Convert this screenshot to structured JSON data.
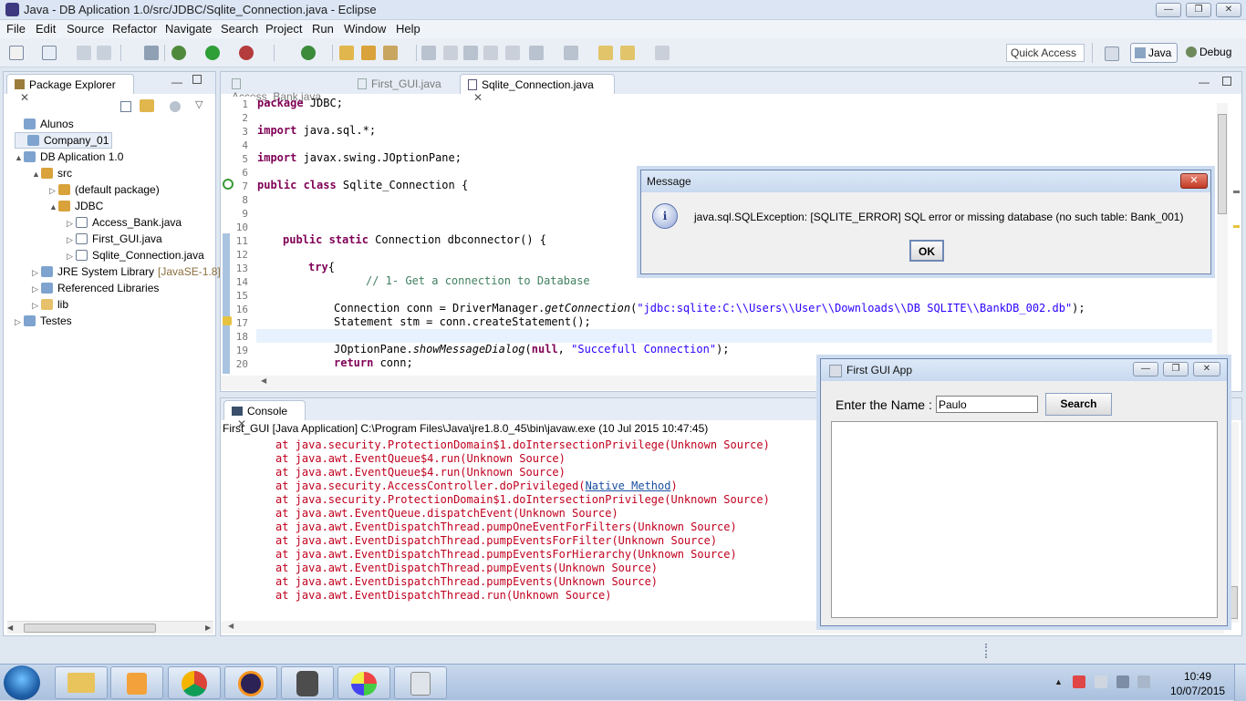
{
  "window": {
    "title": "Java - DB Aplication 1.0/src/JDBC/Sqlite_Connection.java - Eclipse"
  },
  "menu": [
    "File",
    "Edit",
    "Source",
    "Refactor",
    "Navigate",
    "Search",
    "Project",
    "Run",
    "Window",
    "Help"
  ],
  "toolbar": {
    "quick_access": "Quick Access",
    "perspectives": [
      "Java",
      "Debug"
    ]
  },
  "package_explorer": {
    "title": "Package Explorer",
    "items": [
      {
        "label": "Alunos",
        "depth": 0,
        "arrow": ""
      },
      {
        "label": "Company_01",
        "depth": 0,
        "arrow": ""
      },
      {
        "label": "DB Aplication 1.0",
        "depth": 0,
        "arrow": "▲"
      },
      {
        "label": "src",
        "depth": 1,
        "arrow": "▲"
      },
      {
        "label": "(default package)",
        "depth": 2,
        "arrow": "▷"
      },
      {
        "label": "JDBC",
        "depth": 2,
        "arrow": "▲"
      },
      {
        "label": "Access_Bank.java",
        "depth": 3,
        "arrow": "▷"
      },
      {
        "label": "First_GUI.java",
        "depth": 3,
        "arrow": "▷"
      },
      {
        "label": "Sqlite_Connection.java",
        "depth": 3,
        "arrow": "▷"
      },
      {
        "label": "JRE System Library",
        "suffix": "[JavaSE-1.8]",
        "depth": 1,
        "arrow": "▷"
      },
      {
        "label": "Referenced Libraries",
        "depth": 1,
        "arrow": "▷"
      },
      {
        "label": "lib",
        "depth": 1,
        "arrow": "▷"
      },
      {
        "label": "Testes",
        "depth": 0,
        "arrow": "▷"
      }
    ]
  },
  "editor": {
    "tabs": [
      "Access_Bank.java",
      "First_GUI.java",
      "Sqlite_Connection.java"
    ],
    "line_numbers": [
      "1",
      "2",
      "3",
      "4",
      "5",
      "6",
      "7",
      "8",
      "9",
      "10",
      "11",
      "12",
      "13",
      "14",
      "15",
      "16",
      "17",
      "18",
      "19",
      "20"
    ],
    "code": {
      "l1_kw": "package",
      "l1_rest": " JDBC;",
      "l3_kw": "import",
      "l3_rest": " java.sql.*;",
      "l5_kw": "import",
      "l5_rest": " javax.swing.JOptionPane;",
      "l7_kw": "public class",
      "l7_rest": " Sqlite_Connection {",
      "l11_kw": "public static",
      "l11_rest": " Connection dbconnector() {",
      "l13_kw": "try",
      "l13_rest": "{",
      "l14": "// 1- Get a connection to Database",
      "l16_a": "Connection conn = DriverManager.",
      "l16_m": "getConnection",
      "l16_p": "(",
      "l16_s": "\"jdbc:sqlite:C:\\\\Users\\\\User\\\\Downloads\\\\DB SQLITE\\\\BankDB_002.db\"",
      "l16_e": ");",
      "l17": "Statement stm = conn.createStatement();",
      "l19_a": "JOptionPane.",
      "l19_m": "showMessageDialog",
      "l19_p": "(",
      "l19_k": "null",
      "l19_c": ", ",
      "l19_s": "\"Succefull Connection\"",
      "l19_e": ");",
      "l20_kw": "return",
      "l20_rest": " conn;"
    }
  },
  "console": {
    "title": "Console",
    "header": "First_GUI [Java Application] C:\\Program Files\\Java\\jre1.8.0_45\\bin\\javaw.exe (10 Jul 2015 10:47:45)",
    "lines": [
      "at java.security.ProtectionDomain$1.doIntersectionPrivilege(Unknown Source)",
      "at java.awt.EventQueue$4.run(Unknown Source)",
      "at java.awt.EventQueue$4.run(Unknown Source)",
      "at java.security.AccessController.doPrivileged(",
      "at java.security.ProtectionDomain$1.doIntersectionPrivilege(Unknown Source)",
      "at java.awt.EventQueue.dispatchEvent(Unknown Source)",
      "at java.awt.EventDispatchThread.pumpOneEventForFilters(Unknown Source)",
      "at java.awt.EventDispatchThread.pumpEventsForFilter(Unknown Source)",
      "at java.awt.EventDispatchThread.pumpEventsForHierarchy(Unknown Source)",
      "at java.awt.EventDispatchThread.pumpEvents(Unknown Source)",
      "at java.awt.EventDispatchThread.pumpEvents(Unknown Source)",
      "at java.awt.EventDispatchThread.run(Unknown Source)"
    ],
    "native_link": "Native Method",
    "native_close": ")"
  },
  "message_dialog": {
    "title": "Message",
    "text": "java.sql.SQLException: [SQLITE_ERROR] SQL error or missing database (no such table: Bank_001)",
    "ok": "OK",
    "close": "✕"
  },
  "gui_app": {
    "title": "First GUI App",
    "label": "Enter the Name :",
    "value": "Paulo",
    "search": "Search"
  },
  "taskbar": {
    "time": "10:49",
    "date": "10/07/2015"
  },
  "colors": {
    "keyword": "#7f0055",
    "string": "#2a00ff",
    "comment": "#3f7f5f",
    "error": "#c0001e"
  }
}
